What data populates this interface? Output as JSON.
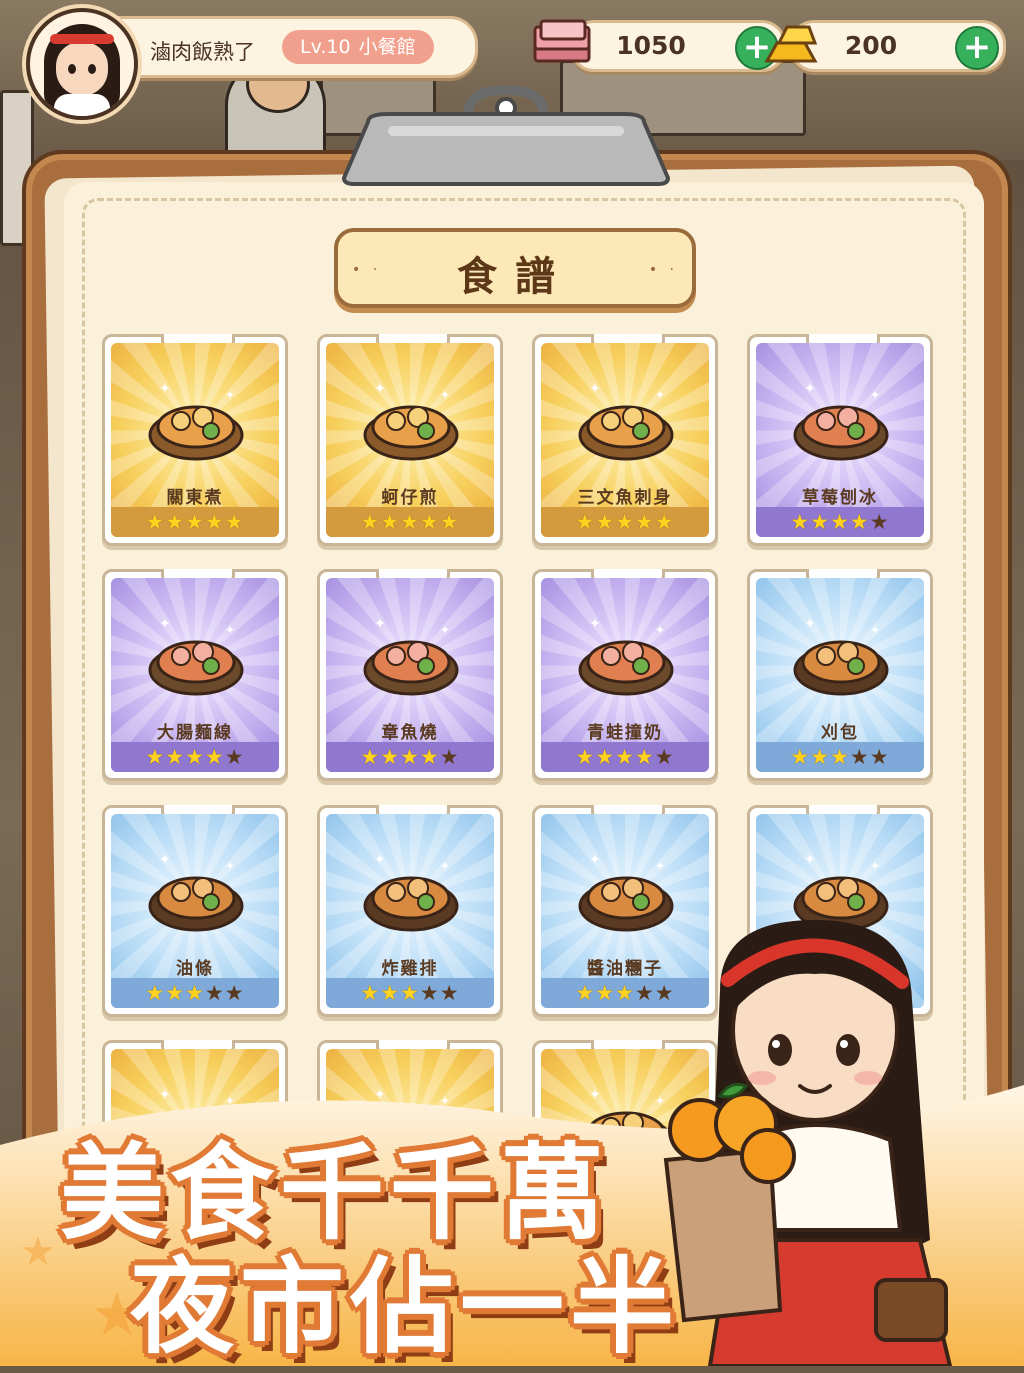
{
  "hud": {
    "player_name": "滷肉飯熟了",
    "level": "Lv.10",
    "shop_title": "小餐館",
    "cash": "1050",
    "gold": "200",
    "plus_symbol": "+",
    "icons": [
      "avatar-portrait",
      "cash-stack-icon",
      "gold-bar-icon",
      "plus-icon"
    ]
  },
  "panel": {
    "title": "食譜",
    "title_dots": "• ·"
  },
  "recipes": [
    {
      "name": "關東煮",
      "rarity": "gold",
      "stars": 5,
      "max_stars": 5,
      "icon": "oden-icon"
    },
    {
      "name": "蚵仔煎",
      "rarity": "gold",
      "stars": 5,
      "max_stars": 5,
      "icon": "oyster-omelette-icon"
    },
    {
      "name": "三文魚刺身",
      "rarity": "gold",
      "stars": 5,
      "max_stars": 5,
      "icon": "salmon-sashimi-icon"
    },
    {
      "name": "草莓刨冰",
      "rarity": "purple",
      "stars": 4,
      "max_stars": 5,
      "icon": "strawberry-shaved-ice-icon"
    },
    {
      "name": "大腸麵線",
      "rarity": "purple",
      "stars": 4,
      "max_stars": 5,
      "icon": "intestine-noodles-icon"
    },
    {
      "name": "章魚燒",
      "rarity": "purple",
      "stars": 4,
      "max_stars": 5,
      "icon": "takoyaki-icon"
    },
    {
      "name": "青蛙撞奶",
      "rarity": "purple",
      "stars": 4,
      "max_stars": 5,
      "icon": "bubble-milk-tea-icon"
    },
    {
      "name": "刈包",
      "rarity": "blue",
      "stars": 3,
      "max_stars": 5,
      "icon": "gua-bao-icon"
    },
    {
      "name": "油條",
      "rarity": "blue",
      "stars": 3,
      "max_stars": 5,
      "icon": "youtiao-icon"
    },
    {
      "name": "炸雞排",
      "rarity": "blue",
      "stars": 3,
      "max_stars": 5,
      "icon": "fried-chicken-cutlet-icon"
    },
    {
      "name": "醬油糰子",
      "rarity": "blue",
      "stars": 3,
      "max_stars": 5,
      "icon": "soy-dango-icon"
    },
    {
      "name": "",
      "rarity": "blue",
      "stars": 0,
      "max_stars": 0,
      "icon": "wrapped-snack-icon"
    },
    {
      "name": "",
      "rarity": "gold",
      "stars": 0,
      "max_stars": 0,
      "icon": "soup-dumpling-icon"
    },
    {
      "name": "",
      "rarity": "gold",
      "stars": 0,
      "max_stars": 0,
      "icon": "sushi-plate-icon"
    },
    {
      "name": "",
      "rarity": "gold",
      "stars": 0,
      "max_stars": 0,
      "icon": "braised-dish-icon"
    }
  ],
  "promo": {
    "line1": "美食千千萬",
    "line2": "夜市佔一半"
  },
  "colors": {
    "gold_card": "#e9a93a",
    "purple_card": "#9c86dc",
    "blue_card": "#85bde8",
    "board_wood": "#a96e3e",
    "plus_green": "#37b05c",
    "slogan_outline": "#e07a34"
  }
}
